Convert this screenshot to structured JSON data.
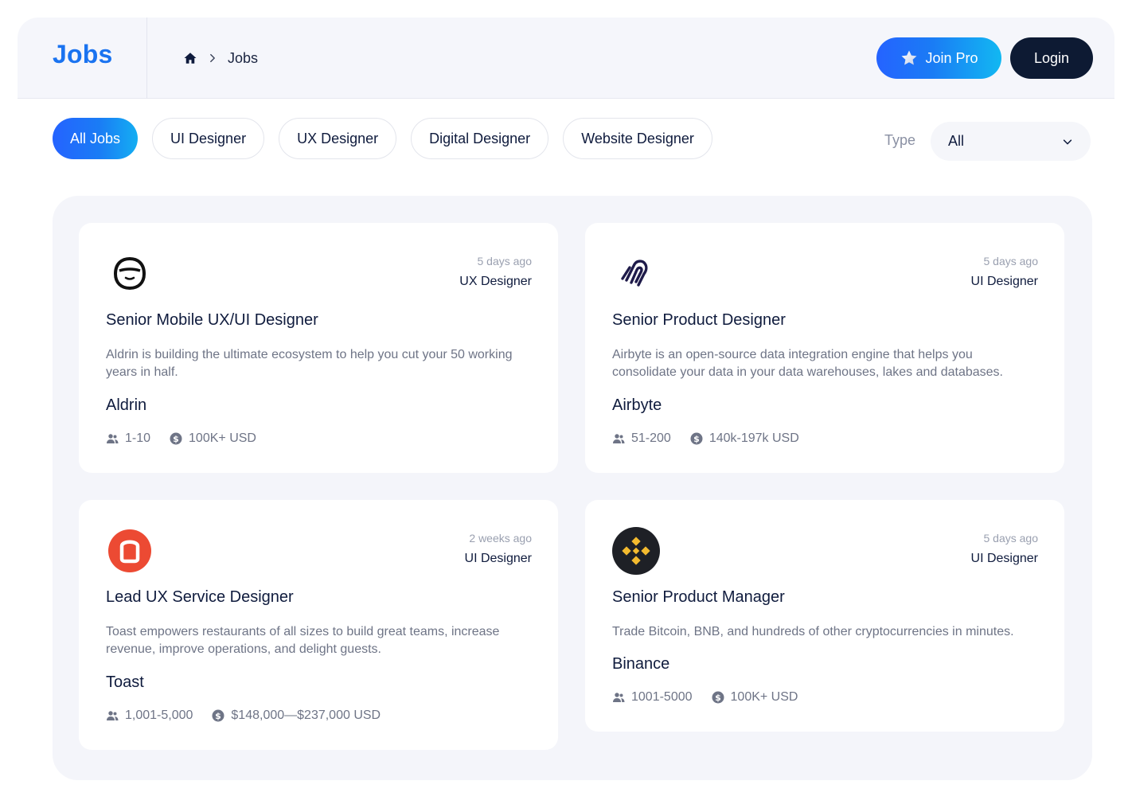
{
  "header": {
    "brand": "Jobs",
    "breadcrumb": {
      "home_icon": "home-icon",
      "current": "Jobs"
    },
    "join_pro_label": "Join Pro",
    "login_label": "Login",
    "accent_gradient": [
      "#2563ff",
      "#12b8f2"
    ],
    "login_color": "#0d1a33"
  },
  "filters": {
    "chips": [
      "All Jobs",
      "UI Designer",
      "UX Designer",
      "Digital Designer",
      "Website Designer"
    ],
    "active": "All Jobs",
    "type_label": "Type",
    "type_value": "All"
  },
  "jobs": [
    {
      "logo": "aldrin-logo",
      "posted": "5 days ago",
      "role": "UX Designer",
      "title": "Senior Mobile UX/UI Designer",
      "description": "Aldrin is building the ultimate ecosystem to help you cut your 50 working years in half.",
      "company": "Aldrin",
      "size": "1-10",
      "salary": "100K+ USD"
    },
    {
      "logo": "airbyte-logo",
      "posted": "5 days ago",
      "role": "UI Designer",
      "title": "Senior Product Designer",
      "description": "Airbyte is an open-source data integration engine that helps you consolidate your data in your data warehouses, lakes and databases.",
      "company": "Airbyte",
      "size": "51-200",
      "salary": "140k-197k USD"
    },
    {
      "logo": "toast-logo",
      "posted": "2 weeks ago",
      "role": "UI Designer",
      "title": "Lead UX Service Designer",
      "description": "Toast empowers restaurants of all sizes to build great teams, increase revenue, improve operations, and delight guests.",
      "company": "Toast",
      "size": "1,001-5,000",
      "salary": "$148,000—$237,000 USD"
    },
    {
      "logo": "binance-logo",
      "posted": "5 days ago",
      "role": "UI Designer",
      "title": "Senior Product Manager",
      "description": "Trade Bitcoin, BNB, and hundreds of other cryptocurrencies in minutes.",
      "company": "Binance",
      "size": "1001-5000",
      "salary": "100K+ USD"
    }
  ]
}
